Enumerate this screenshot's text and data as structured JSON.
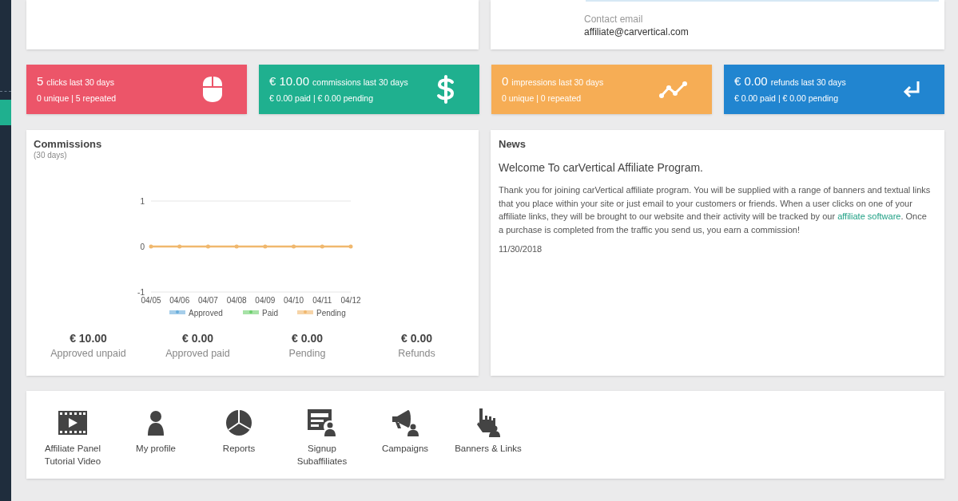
{
  "contact": {
    "label": "Contact email",
    "value": "affiliate@carvertical.com"
  },
  "stats": [
    {
      "kind": "clicks",
      "color": "#ec5569",
      "value": "5",
      "label": "clicks last 30 days",
      "detail": "0 unique | 5 repeated"
    },
    {
      "kind": "commissions",
      "color": "#1fb08f",
      "value": "€ 10.00",
      "label": "commissions last 30 days",
      "detail": "€ 0.00 paid | € 0.00 pending"
    },
    {
      "kind": "impressions",
      "color": "#f6ad55",
      "value": "0",
      "label": "impressions last 30 days",
      "detail": "0 unique | 0 repeated"
    },
    {
      "kind": "refunds",
      "color": "#2185d0",
      "value": "€ 0.00",
      "label": "refunds last 30 days",
      "detail": "€ 0.00 paid | € 0.00 pending"
    }
  ],
  "commissions": {
    "title": "Commissions",
    "subtitle": "(30 days)",
    "chart_data": {
      "type": "line",
      "categories": [
        "04/05",
        "04/06",
        "04/07",
        "04/08",
        "04/09",
        "04/10",
        "04/11",
        "04/12"
      ],
      "yticks": [
        -1,
        0,
        1
      ],
      "ylim": [
        -1,
        1
      ],
      "legend": true,
      "series": [
        {
          "name": "Approved",
          "color": "#6aaedc",
          "values": [
            null,
            null,
            null,
            null,
            null,
            null,
            null,
            null
          ]
        },
        {
          "name": "Paid",
          "color": "#6ccf6c",
          "values": [
            null,
            null,
            null,
            null,
            null,
            null,
            null,
            null
          ]
        },
        {
          "name": "Pending",
          "color": "#f0b86e",
          "values": [
            0,
            0,
            0,
            0,
            0,
            0,
            0,
            0
          ]
        }
      ]
    },
    "totals": [
      {
        "amount": "€ 10.00",
        "label": "Approved unpaid"
      },
      {
        "amount": "€ 0.00",
        "label": "Approved paid"
      },
      {
        "amount": "€ 0.00",
        "label": "Pending"
      },
      {
        "amount": "€ 0.00",
        "label": "Refunds"
      }
    ]
  },
  "news": {
    "title": "News",
    "headline": "Welcome To carVertical Affiliate Program.",
    "text_before": "Thank you for joining carVertical affiliate program. You will be supplied with a range of banners and textual links that you place within your site or just email to your customers or friends. When a user clicks on one of your affiliate links, they will be brought to our website and their activity will be tracked by our ",
    "link": "affiliate software",
    "text_after": ". Once a purchase is completed from the traffic you send us, you earn a commission!",
    "date": "11/30/2018"
  },
  "shortcuts": [
    {
      "kind": "video",
      "label": "Affiliate Panel Tutorial Video"
    },
    {
      "kind": "profile",
      "label": "My profile"
    },
    {
      "kind": "reports",
      "label": "Reports"
    },
    {
      "kind": "signup",
      "label": "Signup Subaffiliates"
    },
    {
      "kind": "campaigns",
      "label": "Campaigns"
    },
    {
      "kind": "banners",
      "label": "Banners & Links"
    }
  ]
}
